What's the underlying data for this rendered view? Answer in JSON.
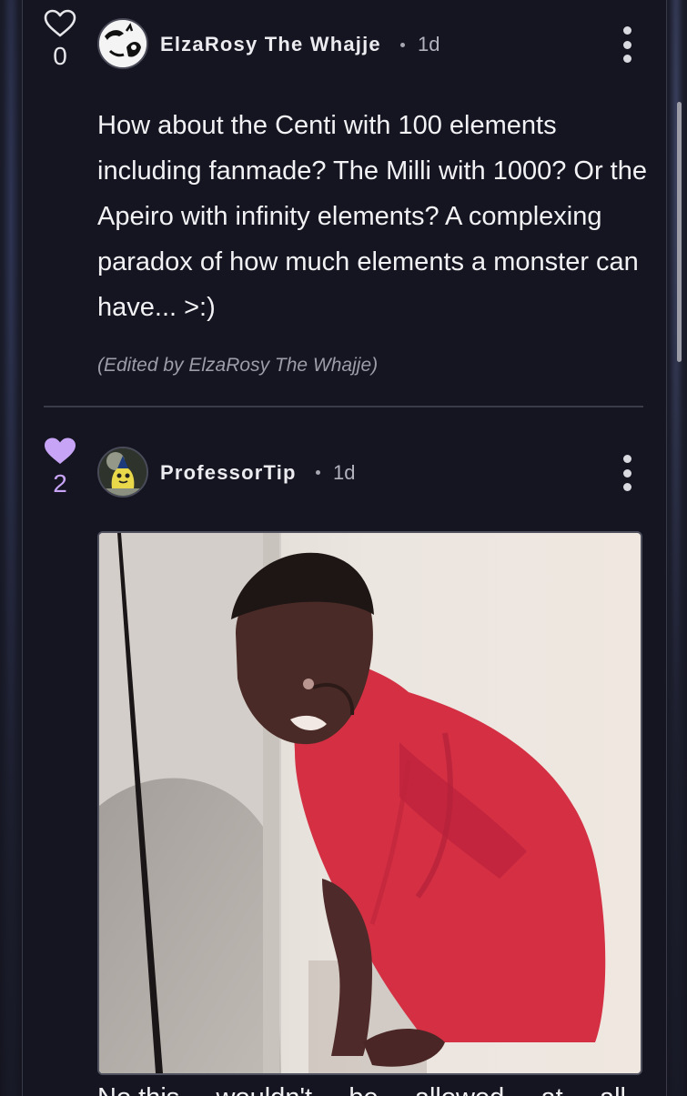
{
  "comments": [
    {
      "likes": "0",
      "liked": false,
      "author": "ElzaRosy The Whajje",
      "time": "1d",
      "body": "How about the Centi with 100 elements including fanmade? The Milli with 1000? Or the Apeiro with infinity elements? A complexing paradox of how much elements a monster can have... >:)",
      "edited_note": "(Edited by ElzaRosy The Whajje)"
    },
    {
      "likes": "2",
      "liked": true,
      "author": "ProfessorTip",
      "time": "1d",
      "media_icon": "reaction-gif",
      "next_text": "No this ... wouldn't ... be ... allowed ... at ... all"
    }
  ],
  "colors": {
    "background": "#141521",
    "liked_accent": "#c7a4f5",
    "text": "#f2f2f5"
  }
}
